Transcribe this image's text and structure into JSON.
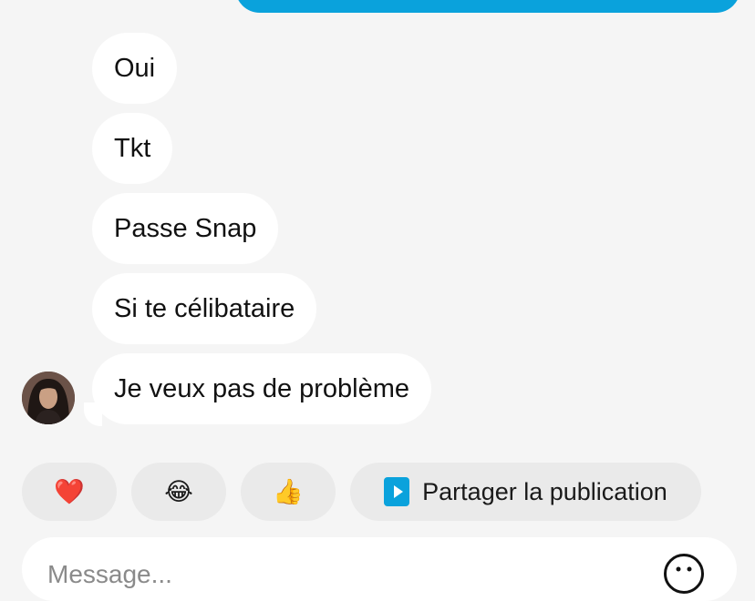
{
  "messages": {
    "received": [
      {
        "text": "Oui"
      },
      {
        "text": "Tkt"
      },
      {
        "text": "Passe Snap"
      },
      {
        "text": "Si te célibataire"
      },
      {
        "text": "Je veux pas de problème"
      }
    ]
  },
  "quick_reactions": {
    "heart": "❤️",
    "laugh": "😂",
    "thumbs_up": "👍",
    "share_label": "Partager la publication"
  },
  "composer": {
    "placeholder": "Message...",
    "value": ""
  },
  "colors": {
    "accent": "#0aa2dc",
    "background": "#f5f5f5",
    "bubble": "#ffffff",
    "chip": "#eaeaea"
  },
  "icons": {
    "share": "play-square-icon",
    "emoji": "smiley-icon"
  }
}
